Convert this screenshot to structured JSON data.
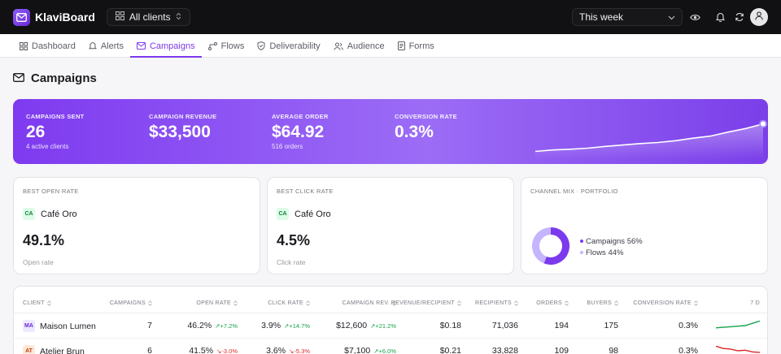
{
  "app": {
    "name": "KlaviBoard"
  },
  "header": {
    "client_selector": "All clients",
    "period": "This week"
  },
  "nav": [
    {
      "label": "Dashboard",
      "icon": "grid-icon"
    },
    {
      "label": "Alerts",
      "icon": "bell-icon"
    },
    {
      "label": "Campaigns",
      "icon": "mail-icon",
      "active": true
    },
    {
      "label": "Flows",
      "icon": "flow-icon"
    },
    {
      "label": "Deliverability",
      "icon": "shield-icon"
    },
    {
      "label": "Audience",
      "icon": "users-icon"
    },
    {
      "label": "Forms",
      "icon": "form-icon"
    }
  ],
  "page": {
    "title": "Campaigns"
  },
  "hero": {
    "kpis": [
      {
        "label": "Campaigns sent",
        "value": "26",
        "sub": "4 active clients"
      },
      {
        "label": "Campaign revenue",
        "value": "$33,500",
        "sub": ""
      },
      {
        "label": "Average order",
        "value": "$64.92",
        "sub": "516 orders"
      },
      {
        "label": "Conversion rate",
        "value": "0.3%",
        "sub": ""
      }
    ],
    "sparkline": [
      0.08,
      0.12,
      0.14,
      0.17,
      0.22,
      0.26,
      0.3,
      0.33,
      0.38,
      0.45,
      0.51,
      0.62,
      0.72,
      0.85
    ]
  },
  "cards": {
    "best_open": {
      "label": "Best open rate",
      "initials": "CA",
      "client": "Café Oro",
      "value": "49.1%",
      "sub": "Open rate"
    },
    "best_click": {
      "label": "Best click rate",
      "initials": "CA",
      "client": "Café Oro",
      "value": "4.5%",
      "sub": "Click rate"
    },
    "channel_mix": {
      "label": "Channel mix · Portfolio",
      "legend": [
        {
          "label": "Campaigns 56%",
          "share": 56,
          "color": "#7c3aed"
        },
        {
          "label": "Flows 44%",
          "share": 44,
          "color": "#c4b5fd"
        }
      ]
    }
  },
  "table": {
    "columns": [
      "Client",
      "Campaigns",
      "Open rate",
      "Click rate",
      "Campaign rev.",
      "Revenue/recipient",
      "Recipients",
      "Orders",
      "Buyers",
      "Conversion rate",
      "7 D"
    ],
    "rows": [
      {
        "initials": "MA",
        "initials_bg": "#ede9fe",
        "initials_fg": "#6d28d9",
        "client": "Maison Lumen",
        "campaigns": "7",
        "open": "46.2%",
        "open_delta": "↗+7.2%",
        "open_dir": "up",
        "click": "3.9%",
        "click_delta": "↗+14.7%",
        "click_dir": "up",
        "rev": "$12,600",
        "rev_delta": "↗+21.2%",
        "rev_dir": "up",
        "rpr": "$0.18",
        "recipients": "71,036",
        "orders": "194",
        "buyers": "175",
        "conv": "0.3%",
        "trend": [
          0.3,
          0.35,
          0.4,
          0.45,
          0.5,
          0.7,
          0.9
        ]
      },
      {
        "initials": "AT",
        "initials_bg": "#fde9d9",
        "initials_fg": "#c2410c",
        "client": "Atelier Brun",
        "campaigns": "6",
        "open": "41.5%",
        "open_delta": "↘-3.0%",
        "open_dir": "down",
        "click": "3.6%",
        "click_delta": "↘-5.3%",
        "click_dir": "down",
        "rev": "$7,100",
        "rev_delta": "↗+6.0%",
        "rev_dir": "up",
        "rpr": "$0.21",
        "recipients": "33,828",
        "orders": "109",
        "buyers": "98",
        "conv": "0.3%",
        "trend": [
          0.9,
          0.7,
          0.65,
          0.5,
          0.55,
          0.4,
          0.35
        ]
      }
    ]
  }
}
